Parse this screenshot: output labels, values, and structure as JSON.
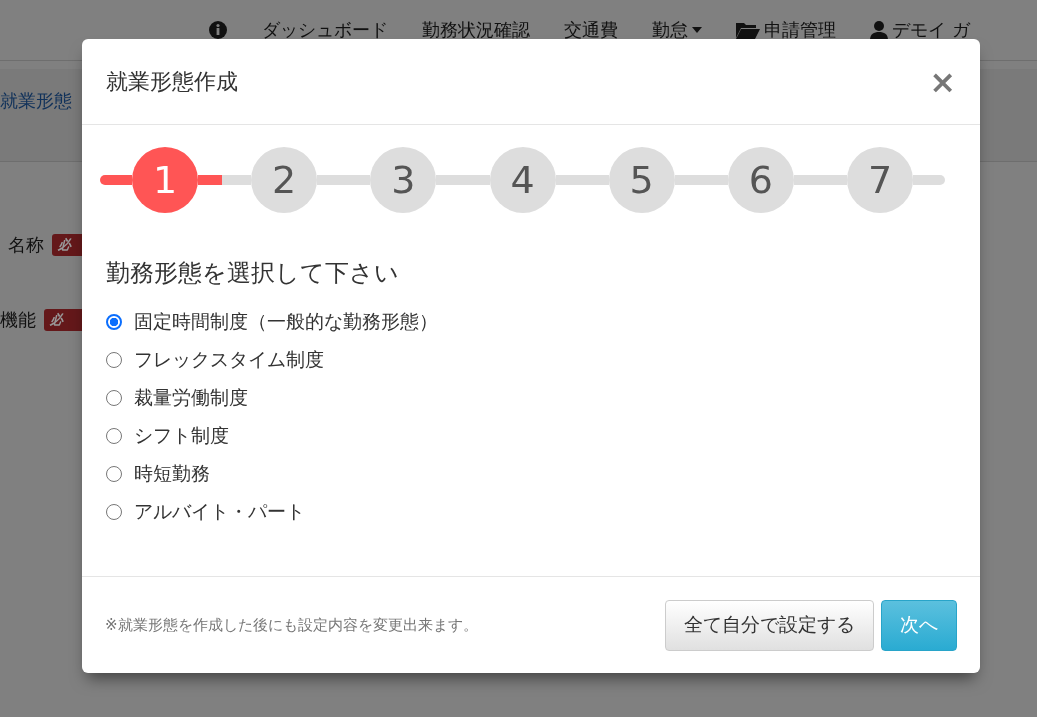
{
  "navbar": {
    "items": [
      {
        "kind": "icon"
      },
      {
        "kind": "text",
        "label": "ダッシュボード"
      },
      {
        "kind": "text",
        "label": "勤務状況確認"
      },
      {
        "kind": "text",
        "label": "交通費"
      },
      {
        "kind": "dropdown",
        "label": "勤怠"
      },
      {
        "kind": "folder",
        "label": "申請管理"
      },
      {
        "kind": "user",
        "label": "デモイ ガ"
      }
    ]
  },
  "breadcrumb": "就業形態",
  "form_rows": [
    {
      "label": "名称",
      "badge": "必"
    },
    {
      "label": "機能",
      "badge": "必"
    }
  ],
  "modal": {
    "title": "就業形態作成",
    "close": "×",
    "steps": [
      {
        "label": "1",
        "selected": true
      },
      {
        "label": "2",
        "selected": false
      },
      {
        "label": "3",
        "selected": false
      },
      {
        "label": "4",
        "selected": false
      },
      {
        "label": "5",
        "selected": false
      },
      {
        "label": "6",
        "selected": false
      },
      {
        "label": "7",
        "selected": false
      }
    ],
    "question": "勤務形態を選択して下さい",
    "options": [
      {
        "label": "固定時間制度（一般的な勤務形態）",
        "selected": true
      },
      {
        "label": "フレックスタイム制度",
        "selected": false
      },
      {
        "label": "裁量労働制度",
        "selected": false
      },
      {
        "label": "シフト制度",
        "selected": false
      },
      {
        "label": "時短勤務",
        "selected": false
      },
      {
        "label": "アルバイト・パート",
        "selected": false
      }
    ],
    "note": "※就業形態を作成した後にも設定内容を変更出来ます。",
    "buttons": [
      {
        "kind": "default",
        "label": "全て自分で設定する"
      },
      {
        "kind": "primary",
        "label": "次へ"
      }
    ]
  }
}
